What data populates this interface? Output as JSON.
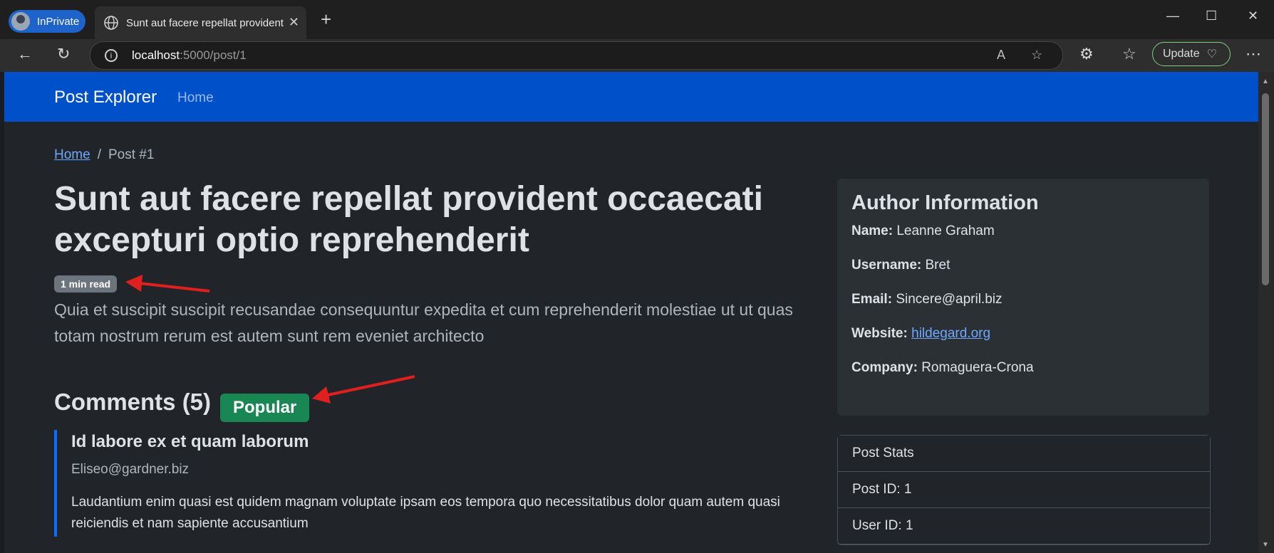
{
  "browser": {
    "inprivate_label": "InPrivate",
    "tab_title": "Sunt aut facere repellat provident",
    "url_host": "localhost",
    "url_rest": ":5000/post/1",
    "update_label": "Update"
  },
  "site": {
    "brand": "Post Explorer",
    "nav_home": "Home"
  },
  "breadcrumb": {
    "home": "Home",
    "current": "Post #1"
  },
  "post": {
    "title": "Sunt aut facere repellat provident occaecati excepturi optio reprehenderit",
    "read_badge": "1 min read",
    "body": "Quia et suscipit suscipit recusandae consequuntur expedita et cum reprehenderit molestiae ut ut quas totam nostrum rerum est autem sunt rem eveniet architecto"
  },
  "comments": {
    "heading": "Comments (5)",
    "popular_badge": "Popular",
    "items": [
      {
        "name": "Id labore ex et quam laborum",
        "email": "Eliseo@gardner.biz",
        "body": "Laudantium enim quasi est quidem magnam voluptate ipsam eos tempora quo necessitatibus dolor quam autem quasi reiciendis et nam sapiente accusantium"
      }
    ]
  },
  "author": {
    "heading": "Author Information",
    "name_label": "Name:",
    "name": "Leanne Graham",
    "username_label": "Username:",
    "username": "Bret",
    "email_label": "Email:",
    "email": "Sincere@april.biz",
    "website_label": "Website:",
    "website": "hildegard.org",
    "company_label": "Company:",
    "company": "Romaguera-Crona"
  },
  "stats": {
    "heading": "Post Stats",
    "post_id": "Post ID: 1",
    "user_id": "User ID: 1"
  },
  "colors": {
    "navbar": "#0050c9",
    "popular": "#198754",
    "read_badge": "#6c757d",
    "annotation_arrow": "#e0201f"
  }
}
